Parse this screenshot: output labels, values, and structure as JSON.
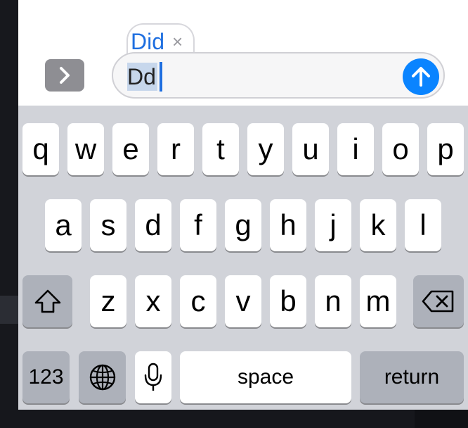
{
  "compose": {
    "suggestion_word": "Did",
    "suggestion_close": "×",
    "input_text": "Dd"
  },
  "keyboard": {
    "row1": [
      "q",
      "w",
      "e",
      "r",
      "t",
      "y",
      "u",
      "i",
      "o",
      "p"
    ],
    "row2": [
      "a",
      "s",
      "d",
      "f",
      "g",
      "h",
      "j",
      "k",
      "l"
    ],
    "row3": [
      "z",
      "x",
      "c",
      "v",
      "b",
      "n",
      "m"
    ],
    "numbers_label": "123",
    "space_label": "space",
    "return_label": "return"
  },
  "colors": {
    "accent": "#0a84ff",
    "keyboard_bg": "#d1d3d9",
    "key": "#ffffff",
    "key_dark": "#adb1ba"
  },
  "icons": [
    "chevron-right-icon",
    "send-arrow-icon",
    "shift-icon",
    "backspace-icon",
    "globe-icon",
    "microphone-icon"
  ]
}
